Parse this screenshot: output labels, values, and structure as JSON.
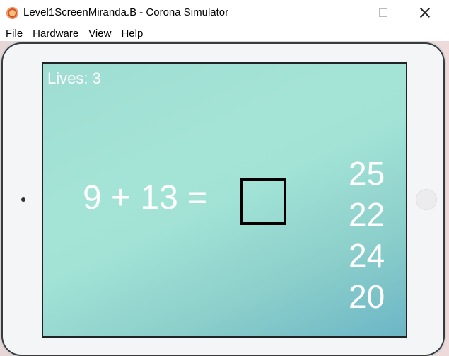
{
  "window": {
    "title": "Level1ScreenMiranda.B - Corona Simulator",
    "icon": "corona-simulator-icon"
  },
  "menu": {
    "items": [
      "File",
      "Hardware",
      "View",
      "Help"
    ]
  },
  "game": {
    "lives_text": "Lives: 3",
    "equation_text": "9 + 13 =",
    "answer_box": "",
    "choices": [
      "25",
      "22",
      "24",
      "20"
    ]
  },
  "colors": {
    "screen_gradient_start": "#a4e4d6",
    "screen_gradient_end": "#6cb6c6",
    "text": "#ffffff",
    "answer_box_border": "#000000"
  }
}
